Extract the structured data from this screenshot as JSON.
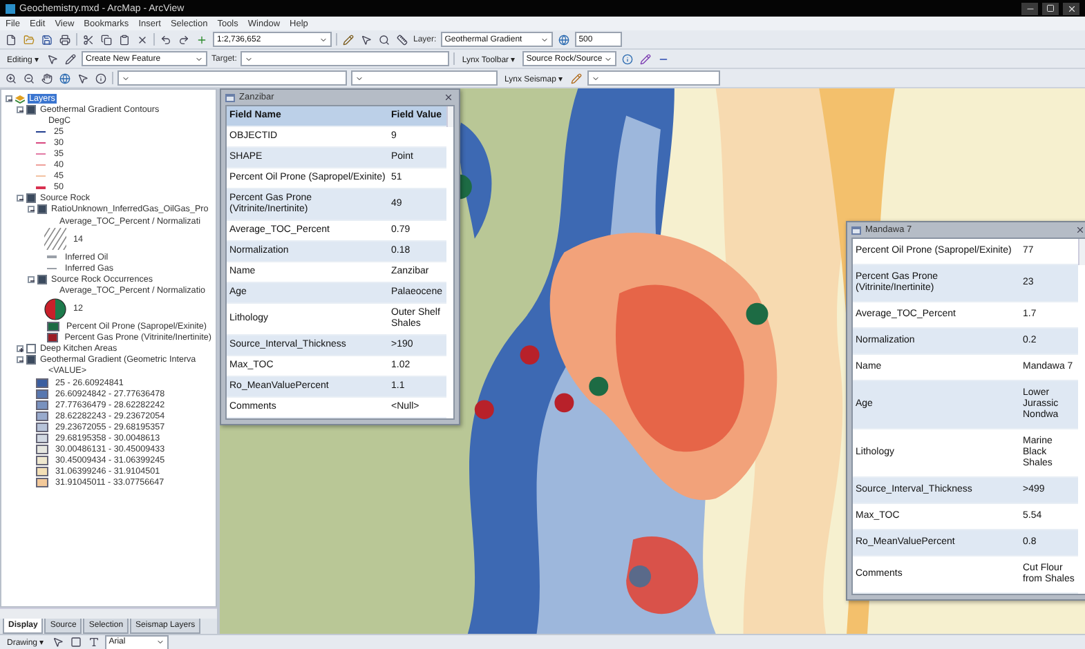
{
  "window": {
    "title": "Geochemistry.mxd - ArcMap - ArcView"
  },
  "menu": [
    "File",
    "Edit",
    "View",
    "Bookmarks",
    "Insert",
    "Selection",
    "Tools",
    "Window",
    "Help"
  ],
  "toolbar_1": {
    "scale": "1:2,736,652",
    "layer_label": "Layer:",
    "layer": "Geothermal Gradient",
    "zoom": "500"
  },
  "toolbar_2": {
    "editing": "Editing ▾",
    "create": "Create New Feature",
    "target": "Target:",
    "lynx": "Lynx Toolbar ▾",
    "source": "Source Rock/Source"
  },
  "toolbar_3": {
    "seismap": "Lynx Seismap ▾"
  },
  "toc": {
    "items": [
      {
        "kind": "frame",
        "label": "Layers",
        "selected": true,
        "expanded": true,
        "children": [
          {
            "kind": "layer",
            "label": "Geothermal Gradient Contours",
            "checked": true,
            "expanded": true,
            "selected": false,
            "children": [
              {
                "kind": "heading",
                "label": "DegC"
              },
              {
                "kind": "line",
                "label": "25",
                "color": "#233f8f"
              },
              {
                "kind": "line",
                "label": "30",
                "color": "#d8477f"
              },
              {
                "kind": "line",
                "label": "35",
                "color": "#e27aa4"
              },
              {
                "kind": "line",
                "label": "40",
                "color": "#ef9f9a"
              },
              {
                "kind": "line",
                "label": "45",
                "color": "#f3c2a1"
              },
              {
                "kind": "line",
                "label": "50",
                "color": "#d83150"
              }
            ]
          },
          {
            "kind": "layer",
            "label": "Source Rock",
            "checked": true,
            "expanded": true,
            "selected": false,
            "children": [
              {
                "kind": "layer",
                "label": "RatioUnknown_InferredGas_OilGas_Pro",
                "checked": true,
                "expanded": true,
                "selected": false,
                "children": [
                  {
                    "kind": "heading",
                    "label": "Average_TOC_Percent / Normalizati"
                  },
                  {
                    "kind": "hatch",
                    "label": "14"
                  },
                  {
                    "kind": "line",
                    "label": "Inferred Oil",
                    "color": "#9aa0a8"
                  },
                  {
                    "kind": "line",
                    "label": "Inferred Gas",
                    "color": "#9aa0a8"
                  }
                ]
              },
              {
                "kind": "layer",
                "label": "Source Rock Occurrences",
                "checked": true,
                "expanded": true,
                "selected": false,
                "children": [
                  {
                    "kind": "heading",
                    "label": "Average_TOC_Percent / Normalizatio"
                  },
                  {
                    "kind": "pie",
                    "label": "12"
                  },
                  {
                    "kind": "fill",
                    "label": "Percent Oil Prone (Sapropel/Exinite)",
                    "color": "#1d6b44"
                  },
                  {
                    "kind": "fill",
                    "label": "Percent Gas Prone (Vitrinite/Inertinite)",
                    "color": "#9b1c24"
                  }
                ]
              }
            ]
          },
          {
            "kind": "layer",
            "label": "Deep Kitchen Areas",
            "checked": false,
            "expanded": false,
            "selected": false
          },
          {
            "kind": "layer",
            "label": "Geothermal Gradient (Geometric Interva",
            "checked": true,
            "expanded": true,
            "selected": false,
            "children": [
              {
                "kind": "heading",
                "label": "<VALUE>"
              },
              {
                "kind": "fill",
                "label": "25 - 26.60924841",
                "color": "#3b5ea0"
              },
              {
                "kind": "fill",
                "label": "26.60924842 - 27.77636478",
                "color": "#5877b0"
              },
              {
                "kind": "fill",
                "label": "27.77636479 - 28.62282242",
                "color": "#7891bf"
              },
              {
                "kind": "fill",
                "label": "28.62282243 - 29.23672054",
                "color": "#98aacd"
              },
              {
                "kind": "fill",
                "label": "29.23672055 - 29.68195357",
                "color": "#b6c3d9"
              },
              {
                "kind": "fill",
                "label": "29.68195358 - 30.0048613",
                "color": "#d2d9e3"
              },
              {
                "kind": "fill",
                "label": "30.00486131 - 30.45009433",
                "color": "#e6e7e0"
              },
              {
                "kind": "fill",
                "label": "30.45009434 - 31.06399245",
                "color": "#efe8cf"
              },
              {
                "kind": "fill",
                "label": "31.06399246 - 31.9104501",
                "color": "#f3dfb6"
              },
              {
                "kind": "fill",
                "label": "31.91045011 - 33.07756647",
                "color": "#f3c99a"
              }
            ]
          }
        ]
      }
    ]
  },
  "toc_tabs": [
    {
      "label": "Display",
      "selected": true
    },
    {
      "label": "Source",
      "selected": false
    },
    {
      "label": "Selection",
      "selected": false
    },
    {
      "label": "Seismap Layers",
      "selected": false
    }
  ],
  "popups": [
    {
      "title": "Zanzibar",
      "header": [
        "Field Name",
        "Field Value"
      ],
      "rows": [
        {
          "field": "OBJECTID",
          "value": "9"
        },
        {
          "field": "SHAPE",
          "value": "Point"
        },
        {
          "field": "Percent Oil Prone (Sapropel/Exinite)",
          "value": "51"
        },
        {
          "field": "Percent Gas Prone (Vitrinite/Inertinite)",
          "value": "49"
        },
        {
          "field": "Average_TOC_Percent",
          "value": "0.79"
        },
        {
          "field": "Normalization",
          "value": "0.18"
        },
        {
          "field": "Name",
          "value": "Zanzibar"
        },
        {
          "field": "Age",
          "value": "Palaeocene"
        },
        {
          "field": "Lithology",
          "value": "Outer Shelf Shales"
        },
        {
          "field": "Source_Interval_Thickness",
          "value": ">190"
        },
        {
          "field": "Max_TOC",
          "value": "1.02"
        },
        {
          "field": "Ro_MeanValuePercent",
          "value": "1.1"
        },
        {
          "field": "Comments",
          "value": "<Null>"
        }
      ]
    },
    {
      "title": "Mandawa 7",
      "rows": [
        {
          "field": "Percent Oil Prone (Sapropel/Exinite)",
          "value": "77"
        },
        {
          "field": "Percent Gas Prone (Vitrinite/Inertinite)",
          "value": "23"
        },
        {
          "field": "Average_TOC_Percent",
          "value": "1.7"
        },
        {
          "field": "Normalization",
          "value": "0.2"
        },
        {
          "field": "Name",
          "value": "Mandawa 7"
        },
        {
          "field": "Age",
          "value": "Lower Jurassic Nondwa"
        },
        {
          "field": "Lithology",
          "value": "Marine Black Shales"
        },
        {
          "field": "Source_Interval_Thickness",
          "value": ">499"
        },
        {
          "field": "Max_TOC",
          "value": "5.54"
        },
        {
          "field": "Ro_MeanValuePercent",
          "value": "0.8"
        },
        {
          "field": "Comments",
          "value": "Cut Flour from Shales"
        }
      ]
    }
  ],
  "drawing_toolbar": {
    "drawing": "Drawing ▾",
    "font": "Arial"
  }
}
